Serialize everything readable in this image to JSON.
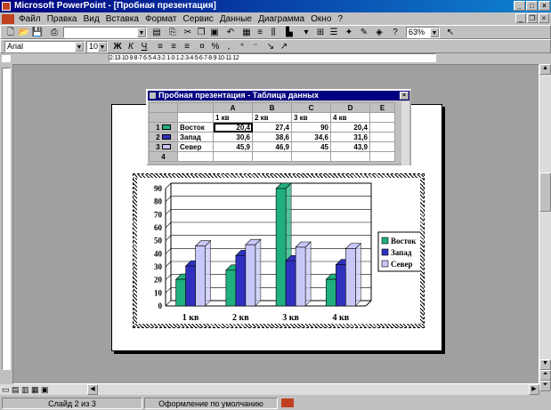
{
  "window": {
    "title": "Microsoft PowerPoint - [Пробная презентация]"
  },
  "menu": [
    "Файл",
    "Правка",
    "Вид",
    "Вставка",
    "Формат",
    "Сервис",
    "Данные",
    "Диаграмма",
    "Окно",
    "?"
  ],
  "toolbar": {
    "font": "Arial",
    "size": "10",
    "zoom": "63%"
  },
  "ruler_h": "2·13·10·9·8·7·6·5·4·3·2·1·0·1·2·3·4·5·6·7·8·9·10·11·12",
  "datasheet": {
    "title": "Пробная презентация - Таблица данных",
    "columns": [
      "A",
      "B",
      "C",
      "D",
      "E"
    ],
    "categories": [
      "1 кв",
      "2 кв",
      "3 кв",
      "4 кв"
    ],
    "rows": [
      {
        "num": "1",
        "name": "Восток",
        "values": [
          "20,4",
          "27,4",
          "90",
          "20,4"
        ]
      },
      {
        "num": "2",
        "name": "Запад",
        "values": [
          "30,6",
          "38,6",
          "34,6",
          "31,6"
        ]
      },
      {
        "num": "3",
        "name": "Север",
        "values": [
          "45,9",
          "46,9",
          "45",
          "43,9"
        ]
      },
      {
        "num": "4",
        "name": "",
        "values": [
          "",
          "",
          "",
          ""
        ]
      }
    ]
  },
  "chart_data": {
    "type": "bar",
    "categories": [
      "1 кв",
      "2 кв",
      "3 кв",
      "4 кв"
    ],
    "series": [
      {
        "name": "Восток",
        "values": [
          20.4,
          27.4,
          90,
          20.4
        ],
        "color": "#20b080"
      },
      {
        "name": "Запад",
        "values": [
          30.6,
          38.6,
          34.6,
          31.6
        ],
        "color": "#3030c0"
      },
      {
        "name": "Север",
        "values": [
          45.9,
          46.9,
          45,
          43.9
        ],
        "color": "#c8c8f8"
      }
    ],
    "yticks": [
      "0",
      "10",
      "20",
      "30",
      "40",
      "50",
      "60",
      "70",
      "80",
      "90"
    ],
    "ylim": [
      0,
      90
    ],
    "legend": "right",
    "grid": true
  },
  "status": {
    "slide": "Слайд 2 из 3",
    "design": "Оформление по умолчанию"
  }
}
